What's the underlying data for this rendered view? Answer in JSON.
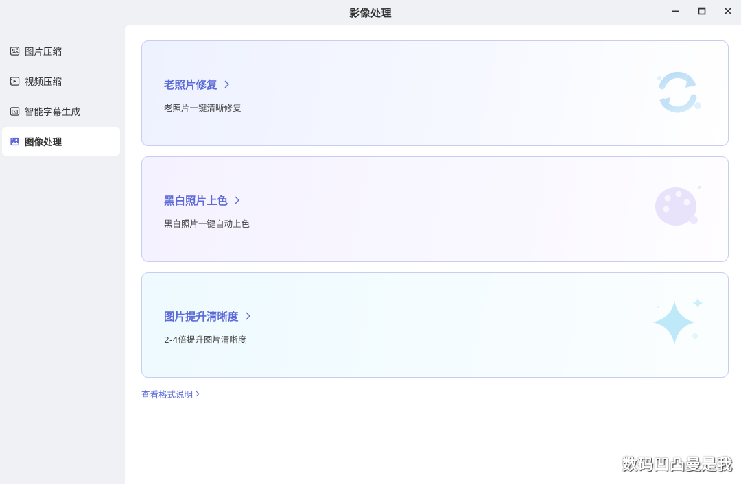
{
  "window": {
    "title": "影像处理",
    "controls": [
      "minimize-icon",
      "maximize-icon",
      "close-icon"
    ]
  },
  "sidebar": {
    "items": [
      {
        "label": "图片压缩",
        "icon": "image-compress-icon",
        "active": false
      },
      {
        "label": "视频压缩",
        "icon": "video-compress-icon",
        "active": false
      },
      {
        "label": "智能字幕生成",
        "icon": "subtitle-icon",
        "active": false
      },
      {
        "label": "图像处理",
        "icon": "image-process-icon",
        "active": true
      }
    ]
  },
  "main": {
    "cards": [
      {
        "title": "老照片修复",
        "description": "老照片一键清晰修复",
        "icon": "refresh-icon"
      },
      {
        "title": "黑白照片上色",
        "description": "黑白照片一键自动上色",
        "icon": "palette-icon"
      },
      {
        "title": "图片提升清晰度",
        "description": "2-4倍提升图片清晰度",
        "icon": "sparkle-icon"
      }
    ],
    "format_link": "查看格式说明"
  },
  "watermark": "数码凹凸曼是我",
  "colors": {
    "accent": "#5b6ad8",
    "card_border": "#c9cdf2",
    "sidebar_bg": "#f0f1f5"
  }
}
